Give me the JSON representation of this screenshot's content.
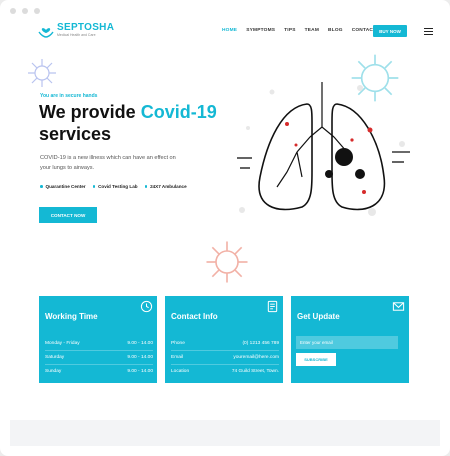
{
  "brand": {
    "name": "SEPTOSHA",
    "tagline": "Medical Health and Care",
    "accent": "#14b8d4"
  },
  "nav": {
    "items": [
      "HOME",
      "SYMPTOMS",
      "TIPS",
      "TEAM",
      "BLOG",
      "CONTACT"
    ],
    "active": "HOME",
    "buy_label": "BUY NOW"
  },
  "hero": {
    "kicker": "You are in secure hands",
    "title_pre": "We provide ",
    "title_highlight": "Covid-19",
    "title_post": " services",
    "description": "COVID-19 is a new illness which can have an effect on your lungs to airways.",
    "features": [
      "Quarantine Center",
      "Covid Testing Lab",
      "24X7 Ambulance"
    ],
    "cta_label": "CONTACT NOW"
  },
  "cards": {
    "working_time": {
      "title": "Working Time",
      "icon": "clock-icon",
      "rows": [
        {
          "label": "Monday - Friday",
          "value": "9.00 - 14.00"
        },
        {
          "label": "Saturday",
          "value": "9.00 - 14.00"
        },
        {
          "label": "Sunday",
          "value": "9.00 - 14.00"
        }
      ]
    },
    "contact_info": {
      "title": "Contact Info",
      "icon": "document-icon",
      "rows": [
        {
          "label": "Phone",
          "value": "(0) 1213 456 789"
        },
        {
          "label": "Email",
          "value": "youremail@here.com"
        },
        {
          "label": "Location",
          "value": "74 Guild Street, Town."
        }
      ]
    },
    "get_update": {
      "title": "Get Update",
      "icon": "mail-icon",
      "email_placeholder": "Enter your email",
      "subscribe_label": "SUBSCRIBE"
    }
  }
}
